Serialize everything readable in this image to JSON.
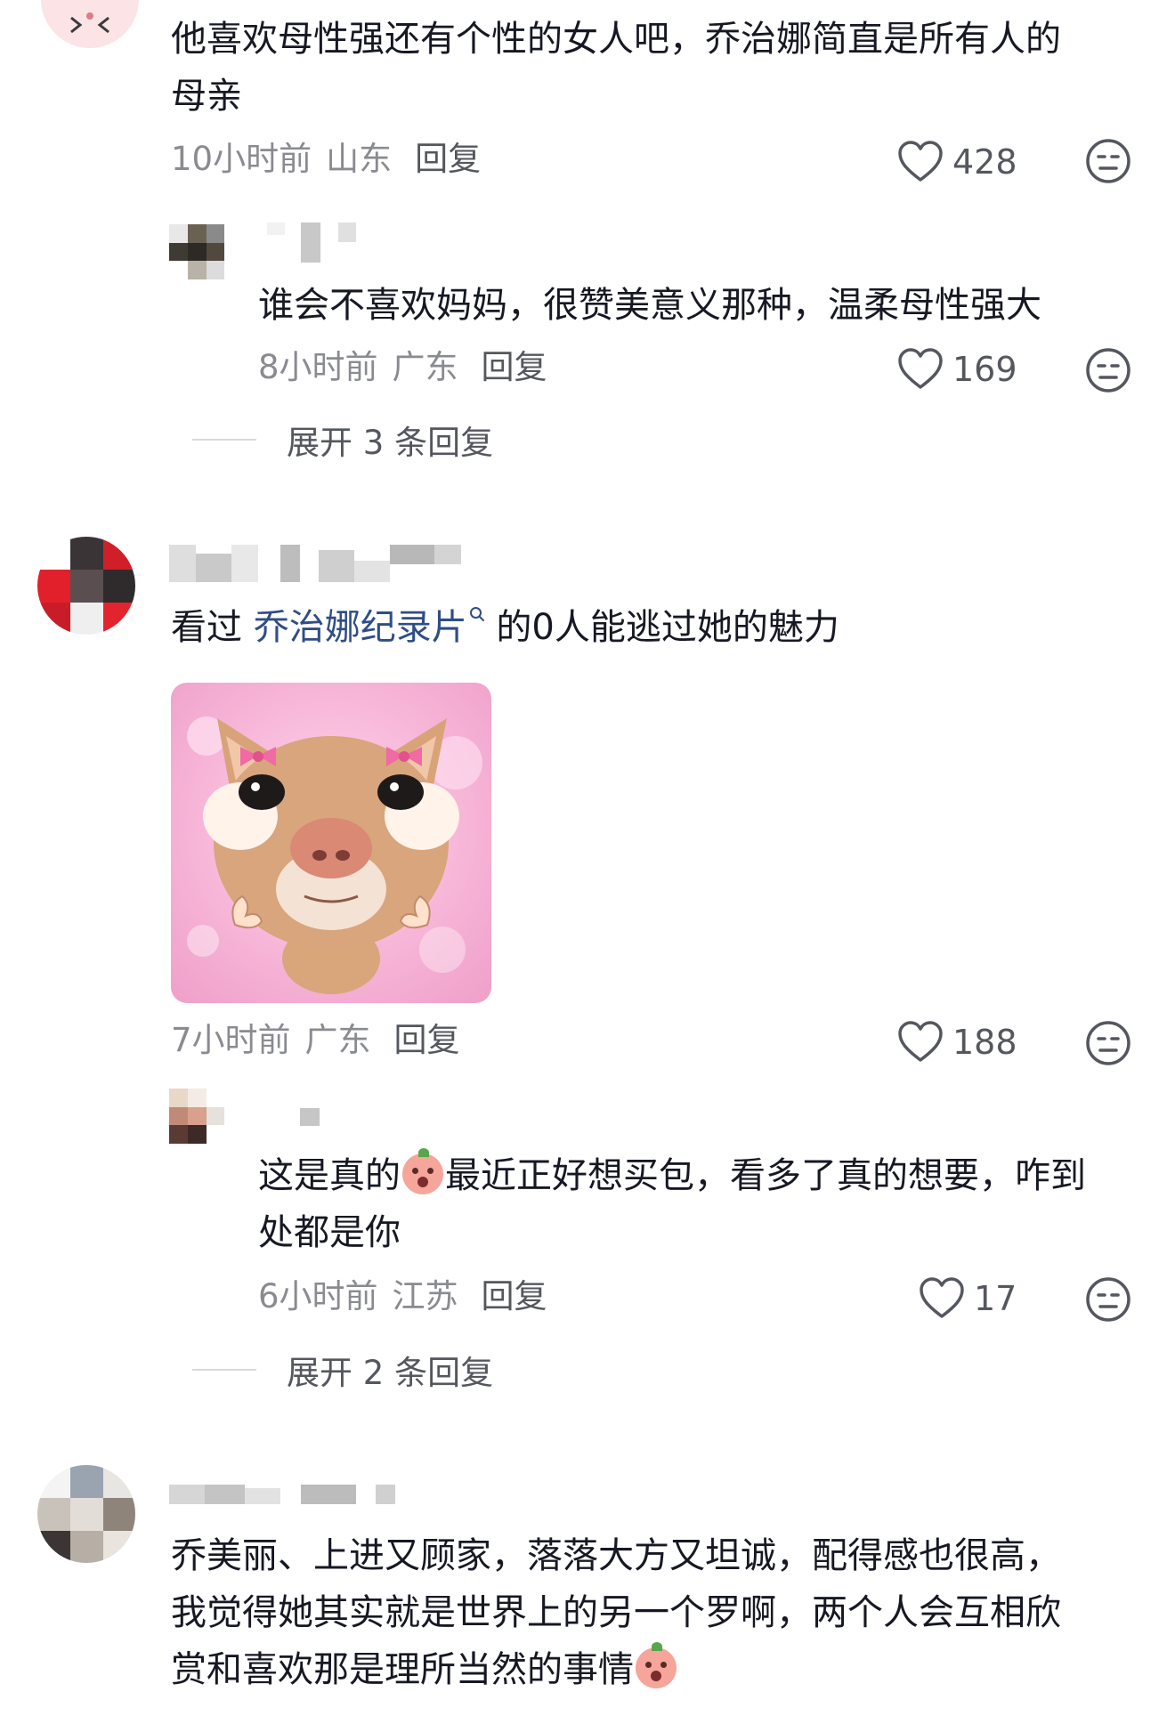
{
  "comments": [
    {
      "text_lines": [
        "他喜欢母性强还有个性的女人吧，乔治娜简直是所有人的",
        "母亲"
      ],
      "time": "10小时前",
      "location": "山东",
      "reply_label": "回复",
      "likes": "428"
    },
    {
      "text_lines": [
        "谁会不喜欢妈妈，很赞美意义那种，温柔母性强大"
      ],
      "time": "8小时前",
      "location": "广东",
      "reply_label": "回复",
      "likes": "169",
      "is_reply": true
    },
    {
      "text_prefix": "看过 ",
      "link_text": "乔治娜纪录片",
      "text_suffix": " 的0人能逃过她的魅力",
      "time": "7小时前",
      "location": "广东",
      "reply_label": "回复",
      "likes": "188"
    },
    {
      "text_line1_a": "这是真的",
      "text_line1_b": "最近正好想买包，看多了真的想要，咋到",
      "text_line2": "处都是你",
      "time": "6小时前",
      "location": "江苏",
      "reply_label": "回复",
      "likes": "17",
      "is_reply": true
    },
    {
      "text_lines": [
        "乔美丽、上进又顾家，落落大方又坦诚，配得感也很高，",
        "我觉得她其实就是世界上的另一个罗啊，两个人会互相欣"
      ],
      "text_line3": "赏和喜欢那是理所当然的事情"
    }
  ],
  "expand": [
    {
      "label": "展开 3 条回复"
    },
    {
      "label": "展开 2 条回复"
    }
  ],
  "colors": {
    "link": "#2f4d86",
    "meta": "#8a8b91",
    "text": "#161823"
  }
}
